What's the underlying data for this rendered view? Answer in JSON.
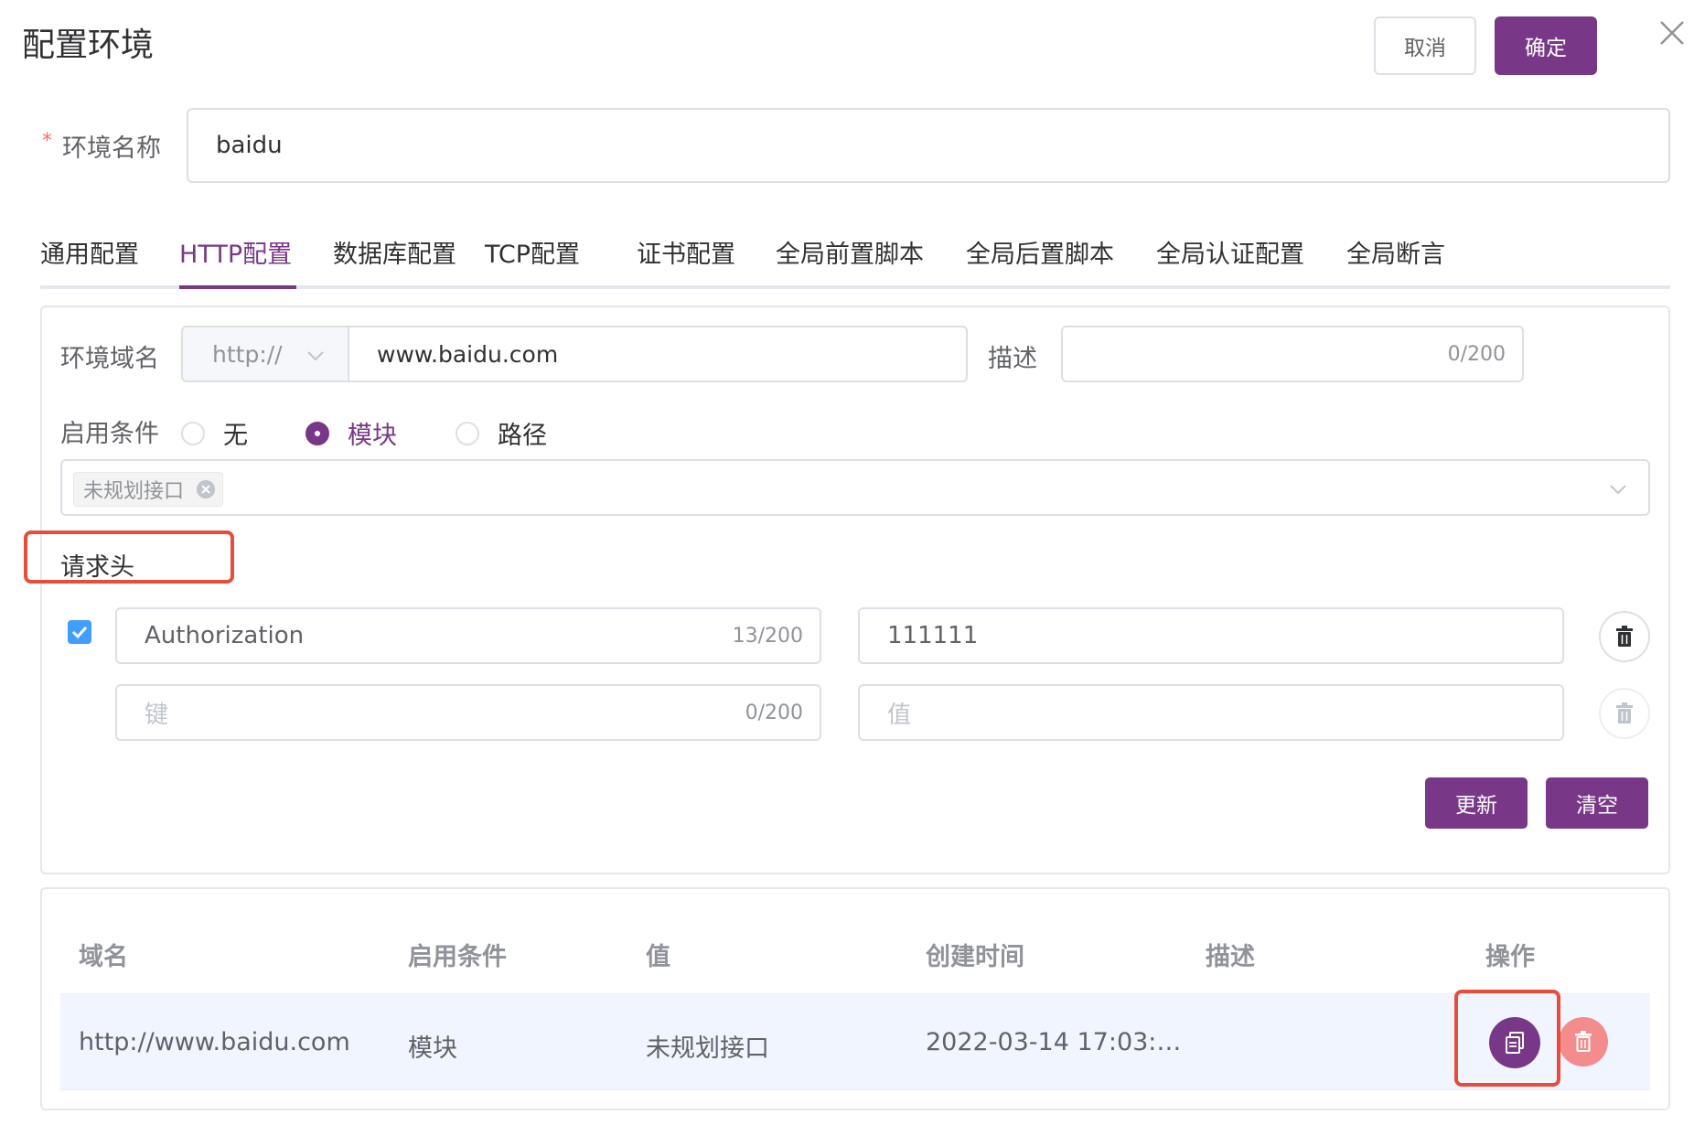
{
  "dialog": {
    "title": "配置环境",
    "cancel_label": "取消",
    "confirm_label": "确定"
  },
  "env_name": {
    "required_mark": "*",
    "label": "环境名称",
    "value": "baidu"
  },
  "tabs": [
    {
      "label": "通用配置",
      "active": false
    },
    {
      "label": "HTTP配置",
      "active": true
    },
    {
      "label": "数据库配置",
      "active": false
    },
    {
      "label": "TCP配置",
      "active": false
    },
    {
      "label": "证书配置",
      "active": false
    },
    {
      "label": "全局前置脚本",
      "active": false
    },
    {
      "label": "全局后置脚本",
      "active": false
    },
    {
      "label": "全局认证配置",
      "active": false
    },
    {
      "label": "全局断言",
      "active": false
    }
  ],
  "http_config": {
    "domain_label": "环境域名",
    "protocol": "http://",
    "domain_value": "www.baidu.com",
    "desc_label": "描述",
    "desc_counter": "0/200",
    "condition_label": "启用条件",
    "conditions": [
      {
        "label": "无",
        "checked": false
      },
      {
        "label": "模块",
        "checked": true
      },
      {
        "label": "路径",
        "checked": false
      }
    ],
    "selected_module_tag": "未规划接口",
    "headers_title": "请求头",
    "headers": [
      {
        "enabled": true,
        "key": "Authorization",
        "key_counter": "13/200",
        "value": "111111"
      },
      {
        "enabled": false,
        "key_placeholder": "键",
        "key_counter": "0/200",
        "value_placeholder": "值"
      }
    ],
    "update_label": "更新",
    "clear_label": "清空"
  },
  "table": {
    "columns": [
      "域名",
      "启用条件",
      "值",
      "创建时间",
      "描述",
      "操作"
    ],
    "rows": [
      {
        "domain": "http://www.baidu.com",
        "condition": "模块",
        "value": "未规划接口",
        "created": "2022-03-14 17:03:…",
        "desc": ""
      }
    ]
  },
  "colors": {
    "primary": "#783887",
    "danger_light": "#f38c8c",
    "highlight_box": "#e74c3c",
    "checkbox": "#409eff"
  }
}
